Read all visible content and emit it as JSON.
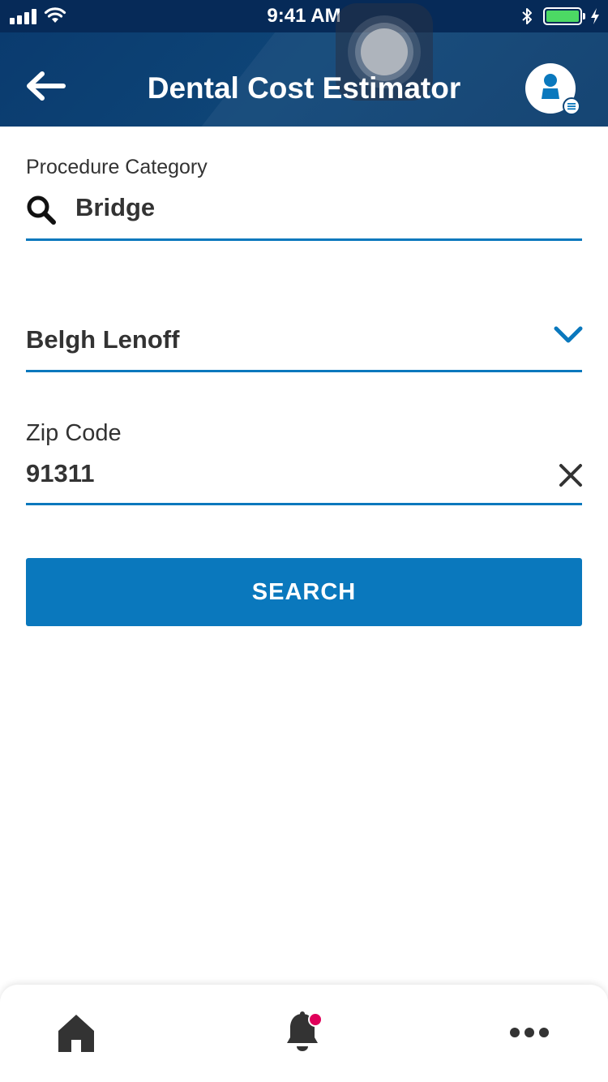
{
  "status_bar": {
    "time": "9:41 AM"
  },
  "header": {
    "title": "Dental Cost Estimator"
  },
  "procedure": {
    "label": "Procedure Category",
    "value": "Bridge"
  },
  "provider": {
    "value": "Belgh Lenoff"
  },
  "zip": {
    "label": "Zip Code",
    "value": "91311"
  },
  "search_button": {
    "label": "SEARCH"
  },
  "colors": {
    "header": "#0e4577",
    "accent": "#0a78bd",
    "notification": "#e0005a",
    "text": "#333333"
  },
  "icons": [
    "back-arrow-icon",
    "profile-icon",
    "search-icon",
    "chevron-down-icon",
    "close-icon",
    "home-icon",
    "bell-icon",
    "more-icon"
  ]
}
